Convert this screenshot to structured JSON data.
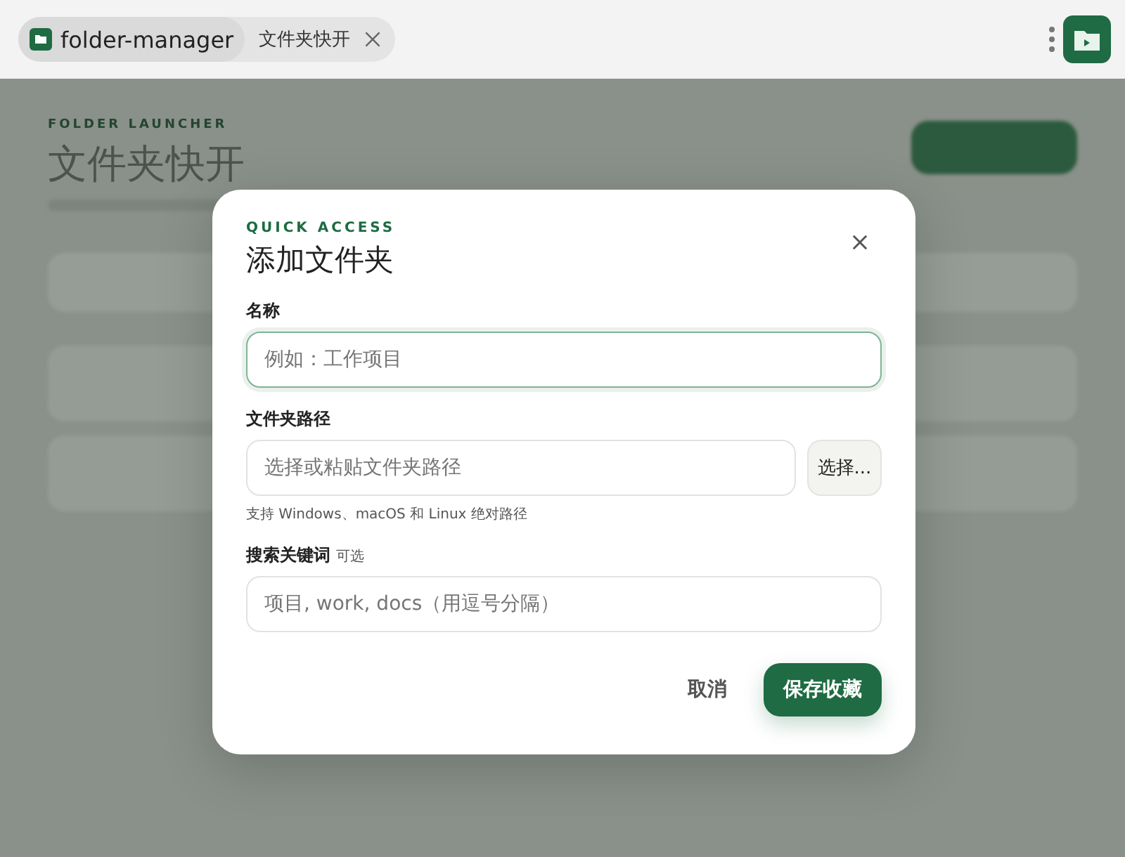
{
  "browser": {
    "tabs": [
      {
        "label": "folder-manager",
        "selected": true,
        "closable": false
      },
      {
        "label": "文件夹快开",
        "selected": false,
        "closable": true
      }
    ]
  },
  "background": {
    "eyebrow": "FOLDER LAUNCHER",
    "title": "文件夹快开"
  },
  "dialog": {
    "eyebrow": "QUICK ACCESS",
    "title": "添加文件夹",
    "fields": [
      {
        "kind": "text",
        "label": "名称",
        "placeholder": "例如：工作项目",
        "focused": true
      },
      {
        "kind": "path",
        "label": "文件夹路径",
        "placeholder": "选择或粘贴文件夹路径",
        "button": "选择...",
        "hint": "支持 Windows、macOS 和 Linux 绝对路径"
      },
      {
        "kind": "text",
        "label": "搜索关键词",
        "optional": "可选",
        "placeholder": "项目, work, docs（用逗号分隔）",
        "focused": false
      }
    ],
    "cancel": "取消",
    "submit": "保存收藏"
  }
}
